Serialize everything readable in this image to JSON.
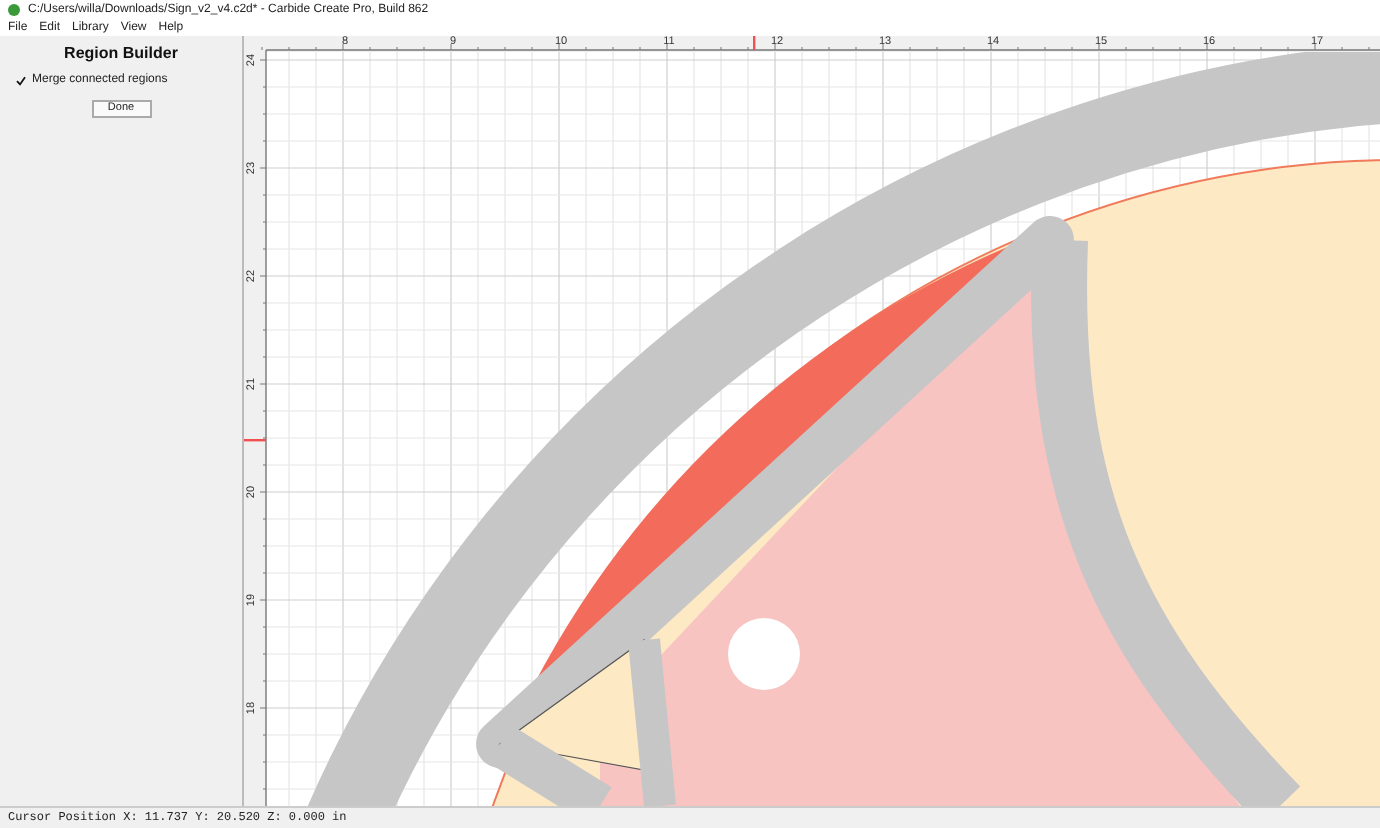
{
  "window": {
    "title": "C:/Users/willa/Downloads/Sign_v2_v4.c2d* - Carbide Create Pro, Build 862"
  },
  "menu": [
    "File",
    "Edit",
    "Library",
    "View",
    "Help"
  ],
  "panel": {
    "title": "Region Builder",
    "options": [
      {
        "label": "Merge connected regions",
        "checked": true
      }
    ],
    "button": "Done"
  },
  "ruler": {
    "x_labels": [
      "8",
      "9",
      "10",
      "11",
      "12",
      "13",
      "14",
      "15",
      "16",
      "17"
    ],
    "y_labels": [
      "24",
      "23",
      "22",
      "21",
      "20",
      "19",
      "18"
    ]
  },
  "status_bar": "Cursor Position X: 11.737 Y: 20.520 Z: 0.000 in"
}
